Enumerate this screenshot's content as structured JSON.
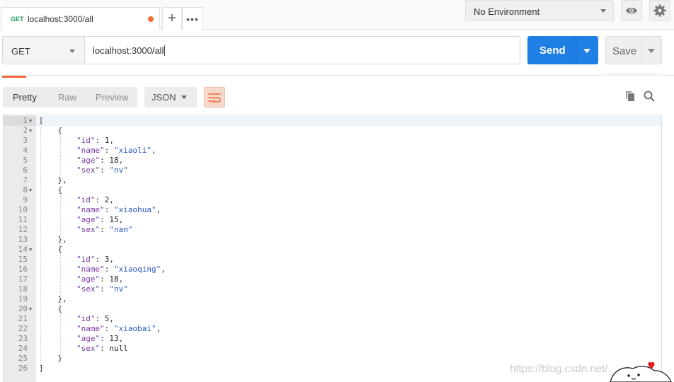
{
  "tab": {
    "method": "GET",
    "title": "localhost:3000/all"
  },
  "environment": {
    "selected": "No Environment"
  },
  "request": {
    "method": "GET",
    "url": "localhost:3000/all",
    "send_label": "Send",
    "save_label": "Save"
  },
  "response_toolbar": {
    "views": [
      "Pretty",
      "Raw",
      "Preview"
    ],
    "active_view": "Pretty",
    "format": "JSON"
  },
  "code_lines": [
    [
      [
        "p",
        "["
      ]
    ],
    [
      [
        "p",
        "    {"
      ]
    ],
    [
      [
        "p",
        "        "
      ],
      [
        "k",
        "\"id\""
      ],
      [
        "p",
        ": "
      ],
      [
        "n",
        "1"
      ],
      [
        "p",
        ","
      ]
    ],
    [
      [
        "p",
        "        "
      ],
      [
        "k",
        "\"name\""
      ],
      [
        "p",
        ": "
      ],
      [
        "s",
        "\"xiaoli\""
      ],
      [
        "p",
        ","
      ]
    ],
    [
      [
        "p",
        "        "
      ],
      [
        "k",
        "\"age\""
      ],
      [
        "p",
        ": "
      ],
      [
        "n",
        "18"
      ],
      [
        "p",
        ","
      ]
    ],
    [
      [
        "p",
        "        "
      ],
      [
        "k",
        "\"sex\""
      ],
      [
        "p",
        ": "
      ],
      [
        "s",
        "\"nv\""
      ]
    ],
    [
      [
        "p",
        "    },"
      ]
    ],
    [
      [
        "p",
        "    {"
      ]
    ],
    [
      [
        "p",
        "        "
      ],
      [
        "k",
        "\"id\""
      ],
      [
        "p",
        ": "
      ],
      [
        "n",
        "2"
      ],
      [
        "p",
        ","
      ]
    ],
    [
      [
        "p",
        "        "
      ],
      [
        "k",
        "\"name\""
      ],
      [
        "p",
        ": "
      ],
      [
        "s",
        "\"xiaohua\""
      ],
      [
        "p",
        ","
      ]
    ],
    [
      [
        "p",
        "        "
      ],
      [
        "k",
        "\"age\""
      ],
      [
        "p",
        ": "
      ],
      [
        "n",
        "15"
      ],
      [
        "p",
        ","
      ]
    ],
    [
      [
        "p",
        "        "
      ],
      [
        "k",
        "\"sex\""
      ],
      [
        "p",
        ": "
      ],
      [
        "s",
        "\"nan\""
      ]
    ],
    [
      [
        "p",
        "    },"
      ]
    ],
    [
      [
        "p",
        "    {"
      ]
    ],
    [
      [
        "p",
        "        "
      ],
      [
        "k",
        "\"id\""
      ],
      [
        "p",
        ": "
      ],
      [
        "n",
        "3"
      ],
      [
        "p",
        ","
      ]
    ],
    [
      [
        "p",
        "        "
      ],
      [
        "k",
        "\"name\""
      ],
      [
        "p",
        ": "
      ],
      [
        "s",
        "\"xiaoqing\""
      ],
      [
        "p",
        ","
      ]
    ],
    [
      [
        "p",
        "        "
      ],
      [
        "k",
        "\"age\""
      ],
      [
        "p",
        ": "
      ],
      [
        "n",
        "18"
      ],
      [
        "p",
        ","
      ]
    ],
    [
      [
        "p",
        "        "
      ],
      [
        "k",
        "\"sex\""
      ],
      [
        "p",
        ": "
      ],
      [
        "s",
        "\"nv\""
      ]
    ],
    [
      [
        "p",
        "    },"
      ]
    ],
    [
      [
        "p",
        "    {"
      ]
    ],
    [
      [
        "p",
        "        "
      ],
      [
        "k",
        "\"id\""
      ],
      [
        "p",
        ": "
      ],
      [
        "n",
        "5"
      ],
      [
        "p",
        ","
      ]
    ],
    [
      [
        "p",
        "        "
      ],
      [
        "k",
        "\"name\""
      ],
      [
        "p",
        ": "
      ],
      [
        "s",
        "\"xiaobai\""
      ],
      [
        "p",
        ","
      ]
    ],
    [
      [
        "p",
        "        "
      ],
      [
        "k",
        "\"age\""
      ],
      [
        "p",
        ": "
      ],
      [
        "n",
        "13"
      ],
      [
        "p",
        ","
      ]
    ],
    [
      [
        "p",
        "        "
      ],
      [
        "k",
        "\"sex\""
      ],
      [
        "p",
        ": "
      ],
      [
        "n",
        "null"
      ]
    ],
    [
      [
        "p",
        "    }"
      ]
    ],
    [
      [
        "p",
        "]"
      ]
    ]
  ],
  "foldable_lines": [
    1,
    2,
    8,
    14,
    20
  ],
  "watermark": "https://blog.csdn.net/",
  "colors": {
    "accent": "#f26b3a",
    "send": "#1f7fe5",
    "key": "#7a3aa3",
    "string": "#2b57c8"
  }
}
